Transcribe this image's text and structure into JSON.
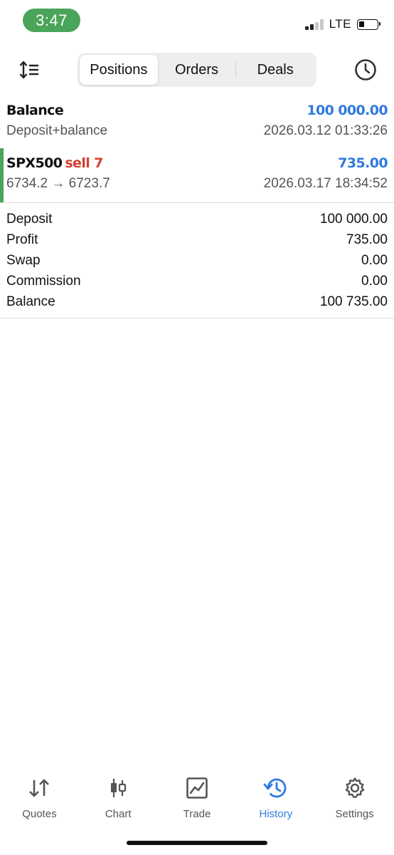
{
  "status_bar": {
    "time": "3:47",
    "network": "LTE",
    "battery_level": 0.3
  },
  "toolbar": {
    "tabs": [
      {
        "label": "Positions",
        "active": true
      },
      {
        "label": "Orders",
        "active": false
      },
      {
        "label": "Deals",
        "active": false
      }
    ]
  },
  "balance_entry": {
    "title": "Balance",
    "amount": "100 000.00",
    "subtitle": "Deposit+balance",
    "timestamp": "2026.03.12 01:33:26"
  },
  "deal_entry": {
    "symbol": "SPX500",
    "side": "sell 7",
    "profit": "735.00",
    "prices": "6734.2 → 6723.7",
    "timestamp": "2026.03.17 18:34:52"
  },
  "summary": {
    "rows": [
      {
        "label": "Deposit",
        "value": "100 000.00"
      },
      {
        "label": "Profit",
        "value": "735.00"
      },
      {
        "label": "Swap",
        "value": "0.00"
      },
      {
        "label": "Commission",
        "value": "0.00"
      },
      {
        "label": "Balance",
        "value": "100 735.00"
      }
    ]
  },
  "bottom_nav": {
    "items": [
      {
        "label": "Quotes",
        "icon": "quotes-arrows-icon",
        "active": false
      },
      {
        "label": "Chart",
        "icon": "candlestick-icon",
        "active": false
      },
      {
        "label": "Trade",
        "icon": "trade-chart-icon",
        "active": false
      },
      {
        "label": "History",
        "icon": "history-clock-icon",
        "active": true
      },
      {
        "label": "Settings",
        "icon": "gear-icon",
        "active": false
      }
    ]
  },
  "colors": {
    "accent_blue": "#2f7ae0",
    "sell_red": "#d34032",
    "buy_green": "#4aa55a"
  }
}
